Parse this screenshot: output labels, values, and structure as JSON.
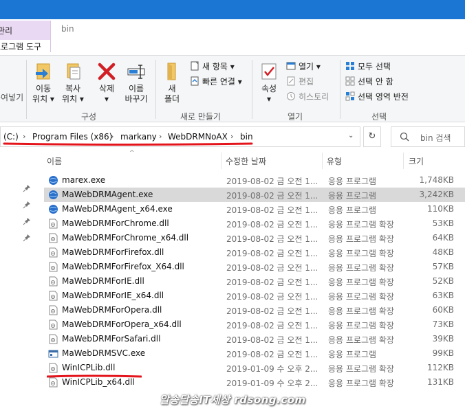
{
  "tabs": {
    "manage": "관리",
    "app_tools": "프로그램 도구",
    "folder": "bin"
  },
  "ribbon": {
    "partial_paste": "붙여넣기",
    "move": "이동\n위치 ▾",
    "copy": "복사\n위치 ▾",
    "delete": "삭제\n▾",
    "rename": "이름\n바꾸기",
    "new_folder": "새\n폴더",
    "new_item": "새 항목",
    "easy_access": "빠른 연결",
    "properties": "속성\n▾",
    "open": "열기",
    "edit": "편집",
    "history": "히스토리",
    "select_all": "모두 선택",
    "select_none": "선택 안 함",
    "invert_selection": "선택 영역 반전",
    "groups": {
      "organize": "구성",
      "new": "새로 만들기",
      "open": "열기",
      "select": "선택"
    }
  },
  "address": {
    "crumbs": [
      "(C:)",
      "Program Files (x86)",
      "markany",
      "WebDRMNoAX",
      "bin"
    ],
    "search_placeholder": "bin 검색"
  },
  "columns": {
    "name": "이름",
    "date": "수정한 날짜",
    "type": "유형",
    "size": "크기"
  },
  "files": [
    {
      "name": "marex.exe",
      "date": "2019-08-02 금 오전 1...",
      "type": "응용 프로그램",
      "size": "1,748KB",
      "icon": "globe-exe-icon"
    },
    {
      "name": "MaWebDRMAgent.exe",
      "date": "2019-08-02 금 오전 1...",
      "type": "응용 프로그램",
      "size": "3,242KB",
      "icon": "globe-exe-icon"
    },
    {
      "name": "MaWebDRMAgent_x64.exe",
      "date": "2019-08-02 금 오전 1...",
      "type": "응용 프로그램",
      "size": "110KB",
      "icon": "globe-exe-icon"
    },
    {
      "name": "MaWebDRMForChrome.dll",
      "date": "2019-08-02 금 오전 1...",
      "type": "응용 프로그램 확장",
      "size": "53KB",
      "icon": "dll-icon"
    },
    {
      "name": "MaWebDRMForChrome_x64.dll",
      "date": "2019-08-02 금 오전 1...",
      "type": "응용 프로그램 확장",
      "size": "64KB",
      "icon": "dll-icon"
    },
    {
      "name": "MaWebDRMForFirefox.dll",
      "date": "2019-08-02 금 오전 1...",
      "type": "응용 프로그램 확장",
      "size": "48KB",
      "icon": "dll-icon"
    },
    {
      "name": "MaWebDRMForFirefox_X64.dll",
      "date": "2019-08-02 금 오전 1...",
      "type": "응용 프로그램 확장",
      "size": "57KB",
      "icon": "dll-icon"
    },
    {
      "name": "MaWebDRMForIE.dll",
      "date": "2019-08-02 금 오전 1...",
      "type": "응용 프로그램 확장",
      "size": "52KB",
      "icon": "dll-icon"
    },
    {
      "name": "MaWebDRMForIE_x64.dll",
      "date": "2019-08-02 금 오전 1...",
      "type": "응용 프로그램 확장",
      "size": "63KB",
      "icon": "dll-icon"
    },
    {
      "name": "MaWebDRMForOpera.dll",
      "date": "2019-08-02 금 오전 1...",
      "type": "응용 프로그램 확장",
      "size": "60KB",
      "icon": "dll-icon"
    },
    {
      "name": "MaWebDRMForOpera_x64.dll",
      "date": "2019-08-02 금 오전 1...",
      "type": "응용 프로그램 확장",
      "size": "73KB",
      "icon": "dll-icon"
    },
    {
      "name": "MaWebDRMForSafari.dll",
      "date": "2019-08-02 금 오전 1...",
      "type": "응용 프로그램 확장",
      "size": "39KB",
      "icon": "dll-icon"
    },
    {
      "name": "MaWebDRMSVC.exe",
      "date": "2019-08-02 금 오전 1...",
      "type": "응용 프로그램",
      "size": "99KB",
      "icon": "window-exe-icon"
    },
    {
      "name": "WinICPLib.dll",
      "date": "2019-01-09 수 오후 2...",
      "type": "응용 프로그램 확장",
      "size": "112KB",
      "icon": "dll-icon"
    },
    {
      "name": "WinICPLib_x64.dll",
      "date": "2019-01-09 수 오후 2...",
      "type": "응용 프로그램 확장",
      "size": "131KB",
      "icon": "dll-icon"
    }
  ],
  "selected_row": 1,
  "watermark": "알송달송IT세상 rdsong.com",
  "colors": {
    "titlebar": "#1b76d3",
    "annotation_red": "#e3141b",
    "selection": "#d9d9d9"
  }
}
